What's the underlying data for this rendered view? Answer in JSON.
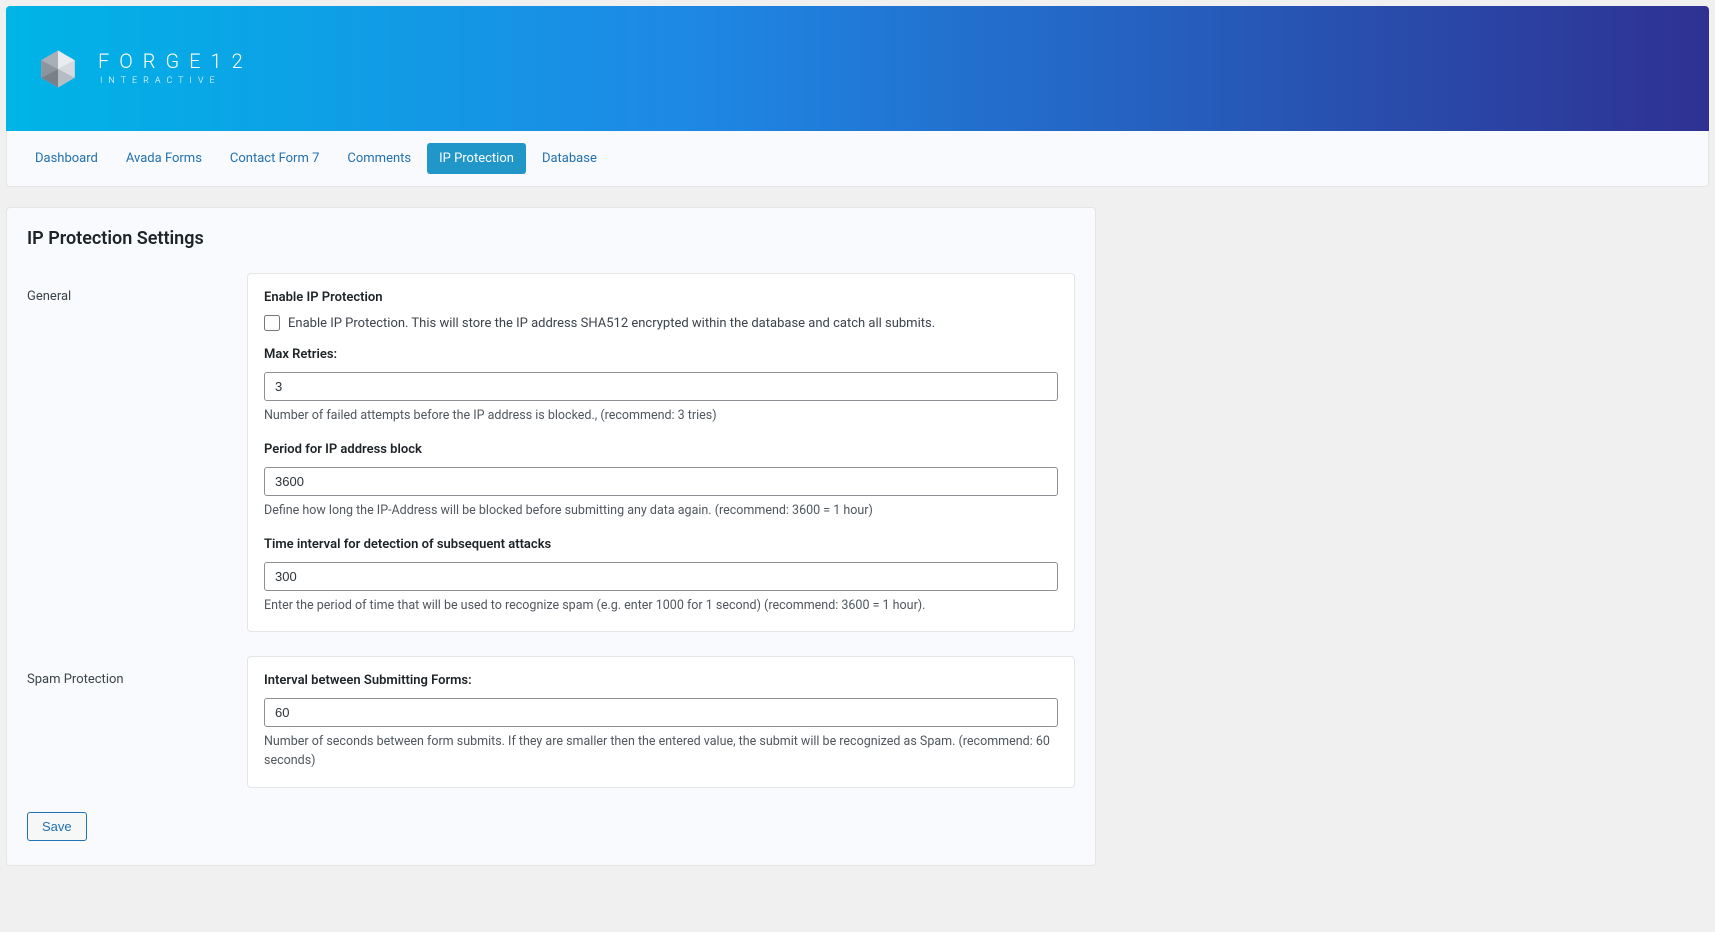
{
  "logo": {
    "main": "FORGE12",
    "sub": "INTERACTIVE"
  },
  "tabs": [
    {
      "label": "Dashboard"
    },
    {
      "label": "Avada Forms"
    },
    {
      "label": "Contact Form 7"
    },
    {
      "label": "Comments"
    },
    {
      "label": "IP Protection"
    },
    {
      "label": "Database"
    }
  ],
  "page": {
    "title": "IP Protection Settings"
  },
  "sections": {
    "general": {
      "label": "General",
      "enable": {
        "title": "Enable IP Protection",
        "desc": "Enable IP Protection. This will store the IP address SHA512 encrypted within the database and catch all submits."
      },
      "maxRetries": {
        "title": "Max Retries:",
        "value": "3",
        "help": "Number of failed attempts before the IP address is blocked., (recommend: 3 tries)"
      },
      "period": {
        "title": "Period for IP address block",
        "value": "3600",
        "help": "Define how long the IP-Address will be blocked before submitting any data again. (recommend: 3600 = 1 hour)"
      },
      "interval": {
        "title": "Time interval for detection of subsequent attacks",
        "value": "300",
        "help": "Enter the period of time that will be used to recognize spam (e.g. enter 1000 for 1 second) (recommend: 3600 = 1 hour)."
      }
    },
    "spam": {
      "label": "Spam Protection",
      "submitInterval": {
        "title": "Interval between Submitting Forms:",
        "value": "60",
        "help": "Number of seconds between form submits. If they are smaller then the entered value, the submit will be recognized as Spam. (recommend: 60 seconds)"
      }
    }
  },
  "buttons": {
    "save": "Save"
  }
}
